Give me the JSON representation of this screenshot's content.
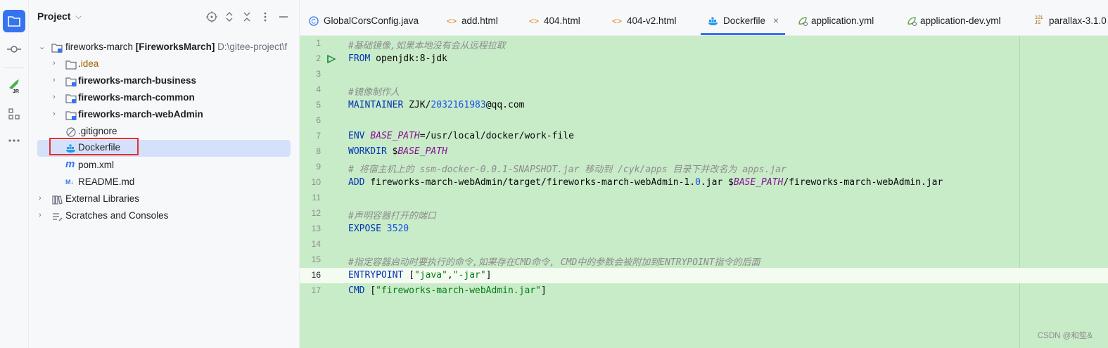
{
  "panel": {
    "title": "Project"
  },
  "tree": {
    "root": {
      "name": "fireworks-march",
      "module": "[FireworksMarch]",
      "path": "D:\\gitee-project\\f"
    },
    "items": [
      {
        "label": "idea",
        "dot": "."
      },
      {
        "label": "fireworks-march-business"
      },
      {
        "label": "fireworks-march-common"
      },
      {
        "label": "fireworks-march-webAdmin"
      },
      {
        "label": ".gitignore"
      },
      {
        "label": "Dockerfile"
      },
      {
        "label": "pom.xml"
      },
      {
        "label": "README.md"
      },
      {
        "label": "External Libraries"
      },
      {
        "label": "Scratches and Consoles"
      }
    ]
  },
  "tabs": [
    {
      "label": "GlobalCorsConfig.java",
      "icon": "java-class-icon"
    },
    {
      "label": "add.html",
      "icon": "html-icon"
    },
    {
      "label": "404.html",
      "icon": "html-icon"
    },
    {
      "label": "404-v2.html",
      "icon": "html-icon"
    },
    {
      "label": "Dockerfile",
      "icon": "docker-icon",
      "close": "×"
    },
    {
      "label": "application.yml",
      "icon": "spring-config-icon"
    },
    {
      "label": "application-dev.yml",
      "icon": "spring-config-icon"
    },
    {
      "label": "parallax-3.1.0",
      "icon": "js-file-icon"
    }
  ],
  "code": {
    "l1": "#基础镜像,如果本地没有会从远程拉取",
    "l2a": "FROM",
    "l2b": " openjdk:8-jdk",
    "l4": "#镜像制作人",
    "l5a": "MAINTAINER",
    "l5b": " ZJK/",
    "l5c": "2032161983",
    "l5d": "@qq.com",
    "l7a": "ENV",
    "l7b": "BASE_PATH",
    "l7c": "=/usr/local/docker/work-file",
    "l8a": "WORKDIR",
    "l8b": " $",
    "l8c": "BASE_PATH",
    "l9": "# 将宿主机上的 ssm-docker-0.0.1-SNAPSHOT.jar 移动到 /cyk/apps 目录下并改名为 apps.jar",
    "l10a": "ADD",
    "l10b": " fireworks-march-webAdmin/target/fireworks-march-webAdmin-1.",
    "l10c": "0",
    "l10d": ".jar $",
    "l10e": "BASE_PATH",
    "l10f": "/fireworks-march-webAdmin.jar",
    "l12": "#声明容器打开的端口",
    "l13a": "EXPOSE",
    "l13b": "3520",
    "l15": "#指定容器启动时要执行的命令,如果存在CMD命令, CMD中的参数会被附加到ENTRYPOINT指令的后面",
    "l16a": "ENTRYPOINT",
    "l16b": " [",
    "l16c": "\"java\"",
    "l16d": ",",
    "l16e": "\"-jar\"",
    "l16f": "]",
    "l17a": "CMD",
    "l17b": " [",
    "l17c": "\"fireworks-march-webAdmin.jar\"",
    "l17d": "]"
  },
  "watermark": "CSDN @和笙&",
  "colors": {
    "accent": "#3574f0",
    "editor_bg": "#c8ebc8",
    "highlight": "#e03131"
  }
}
